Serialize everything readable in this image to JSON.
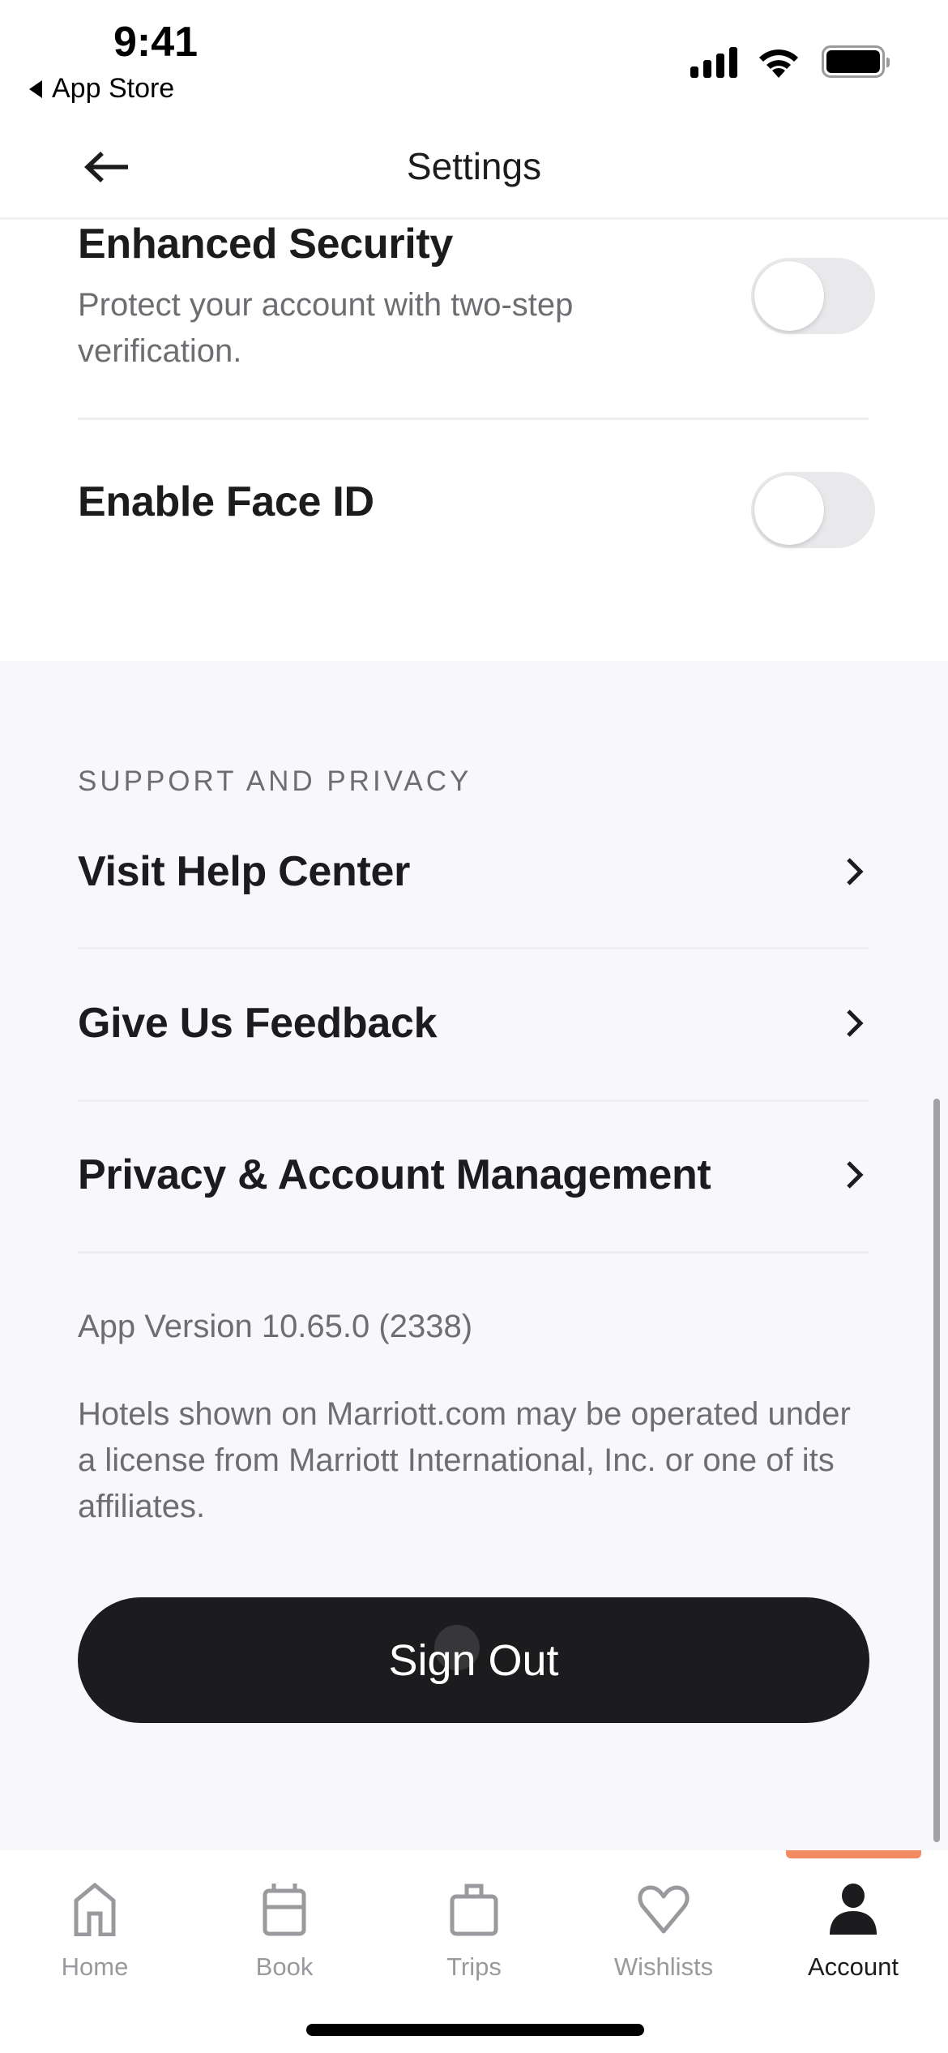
{
  "status_bar": {
    "time": "9:41",
    "back_app_label": "App Store",
    "icons": [
      "cellular-signal-icon",
      "wifi-icon",
      "battery-icon"
    ]
  },
  "header": {
    "back_icon": "arrow-left-icon",
    "title": "Settings"
  },
  "security": {
    "enhanced_security": {
      "title": "Enhanced Security",
      "description": "Protect your account with two-step verification.",
      "enabled": false
    },
    "face_id": {
      "title": "Enable Face ID",
      "enabled": false
    }
  },
  "support": {
    "section_label": "SUPPORT AND PRIVACY",
    "items": [
      {
        "label": "Visit Help Center",
        "icon": "chevron-right-icon"
      },
      {
        "label": "Give Us Feedback",
        "icon": "chevron-right-icon"
      },
      {
        "label": "Privacy & Account Management",
        "icon": "chevron-right-icon"
      }
    ],
    "app_version": "App Version 10.65.0 (2338)",
    "disclaimer": "Hotels shown on Marriott.com may be operated under a license from Marriott International, Inc. or one of its affiliates."
  },
  "sign_out": {
    "label": "Sign Out"
  },
  "tab_bar": {
    "active_index": 4,
    "accent_color": "#F28B61",
    "tabs": [
      {
        "label": "Home",
        "icon": "home-icon"
      },
      {
        "label": "Book",
        "icon": "calendar-icon"
      },
      {
        "label": "Trips",
        "icon": "suitcase-icon"
      },
      {
        "label": "Wishlists",
        "icon": "heart-icon"
      },
      {
        "label": "Account",
        "icon": "person-icon"
      }
    ]
  }
}
